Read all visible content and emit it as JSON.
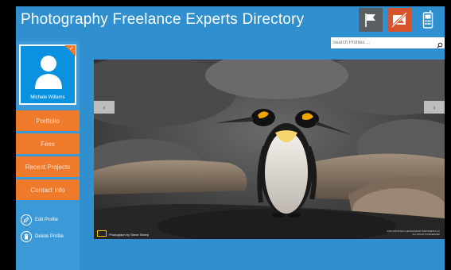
{
  "app": {
    "title": "Photography Freelance Experts Directory",
    "accent": "#2f8fcf",
    "orange": "#f07a2b"
  },
  "toolbar": {
    "icons": [
      "flag-icon",
      "no-image-icon",
      "phone-icon"
    ]
  },
  "search": {
    "placeholder": "Search Profiles ..."
  },
  "profile": {
    "name": "Michele Willams",
    "selected": true
  },
  "nav": [
    {
      "label": "Portfolio"
    },
    {
      "label": "Fees"
    },
    {
      "label": "Recent Projects"
    },
    {
      "label": "Contact Info"
    }
  ],
  "actions": {
    "edit": "Edit Profile",
    "delete": "Delete Profile"
  },
  "photo": {
    "description_icons": [
      "prev-arrow-icon",
      "next-arrow-icon"
    ],
    "credit": "Photograph by Steve Sheep",
    "copyright": "2015 NATIONAL GEOGRAPHIC PARTNERS LLC ALL RIGHTS RESERVED"
  }
}
